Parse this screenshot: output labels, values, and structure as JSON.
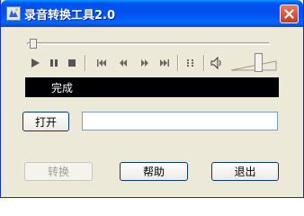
{
  "window": {
    "title": "录音转换工具2.0",
    "close_icon": "close-icon",
    "app_icon": "app-icon"
  },
  "player": {
    "seek_position": 0.02,
    "buttons": [
      {
        "name": "play-button",
        "icon": "play-icon"
      },
      {
        "name": "pause-button",
        "icon": "pause-icon"
      },
      {
        "name": "stop-button",
        "icon": "stop-icon"
      },
      {
        "name": "skip-back-button",
        "icon": "skip-to-start-icon"
      },
      {
        "name": "rewind-button",
        "icon": "rewind-icon"
      },
      {
        "name": "fast-forward-button",
        "icon": "fast-forward-icon"
      },
      {
        "name": "skip-forward-button",
        "icon": "skip-to-end-icon"
      },
      {
        "name": "playlist-button",
        "icon": "playlist-icon"
      },
      {
        "name": "mute-button",
        "icon": "speaker-icon"
      }
    ],
    "volume": 0.6
  },
  "status": {
    "text": "完成"
  },
  "file": {
    "open_label": "打开",
    "path_value": ""
  },
  "actions": {
    "convert_label": "转换",
    "convert_enabled": false,
    "help_label": "帮助",
    "exit_label": "退出"
  },
  "colors": {
    "titlebar": "#0054e3",
    "face": "#ece9d8",
    "status_bg": "#000000",
    "status_fg": "#ffffff"
  }
}
